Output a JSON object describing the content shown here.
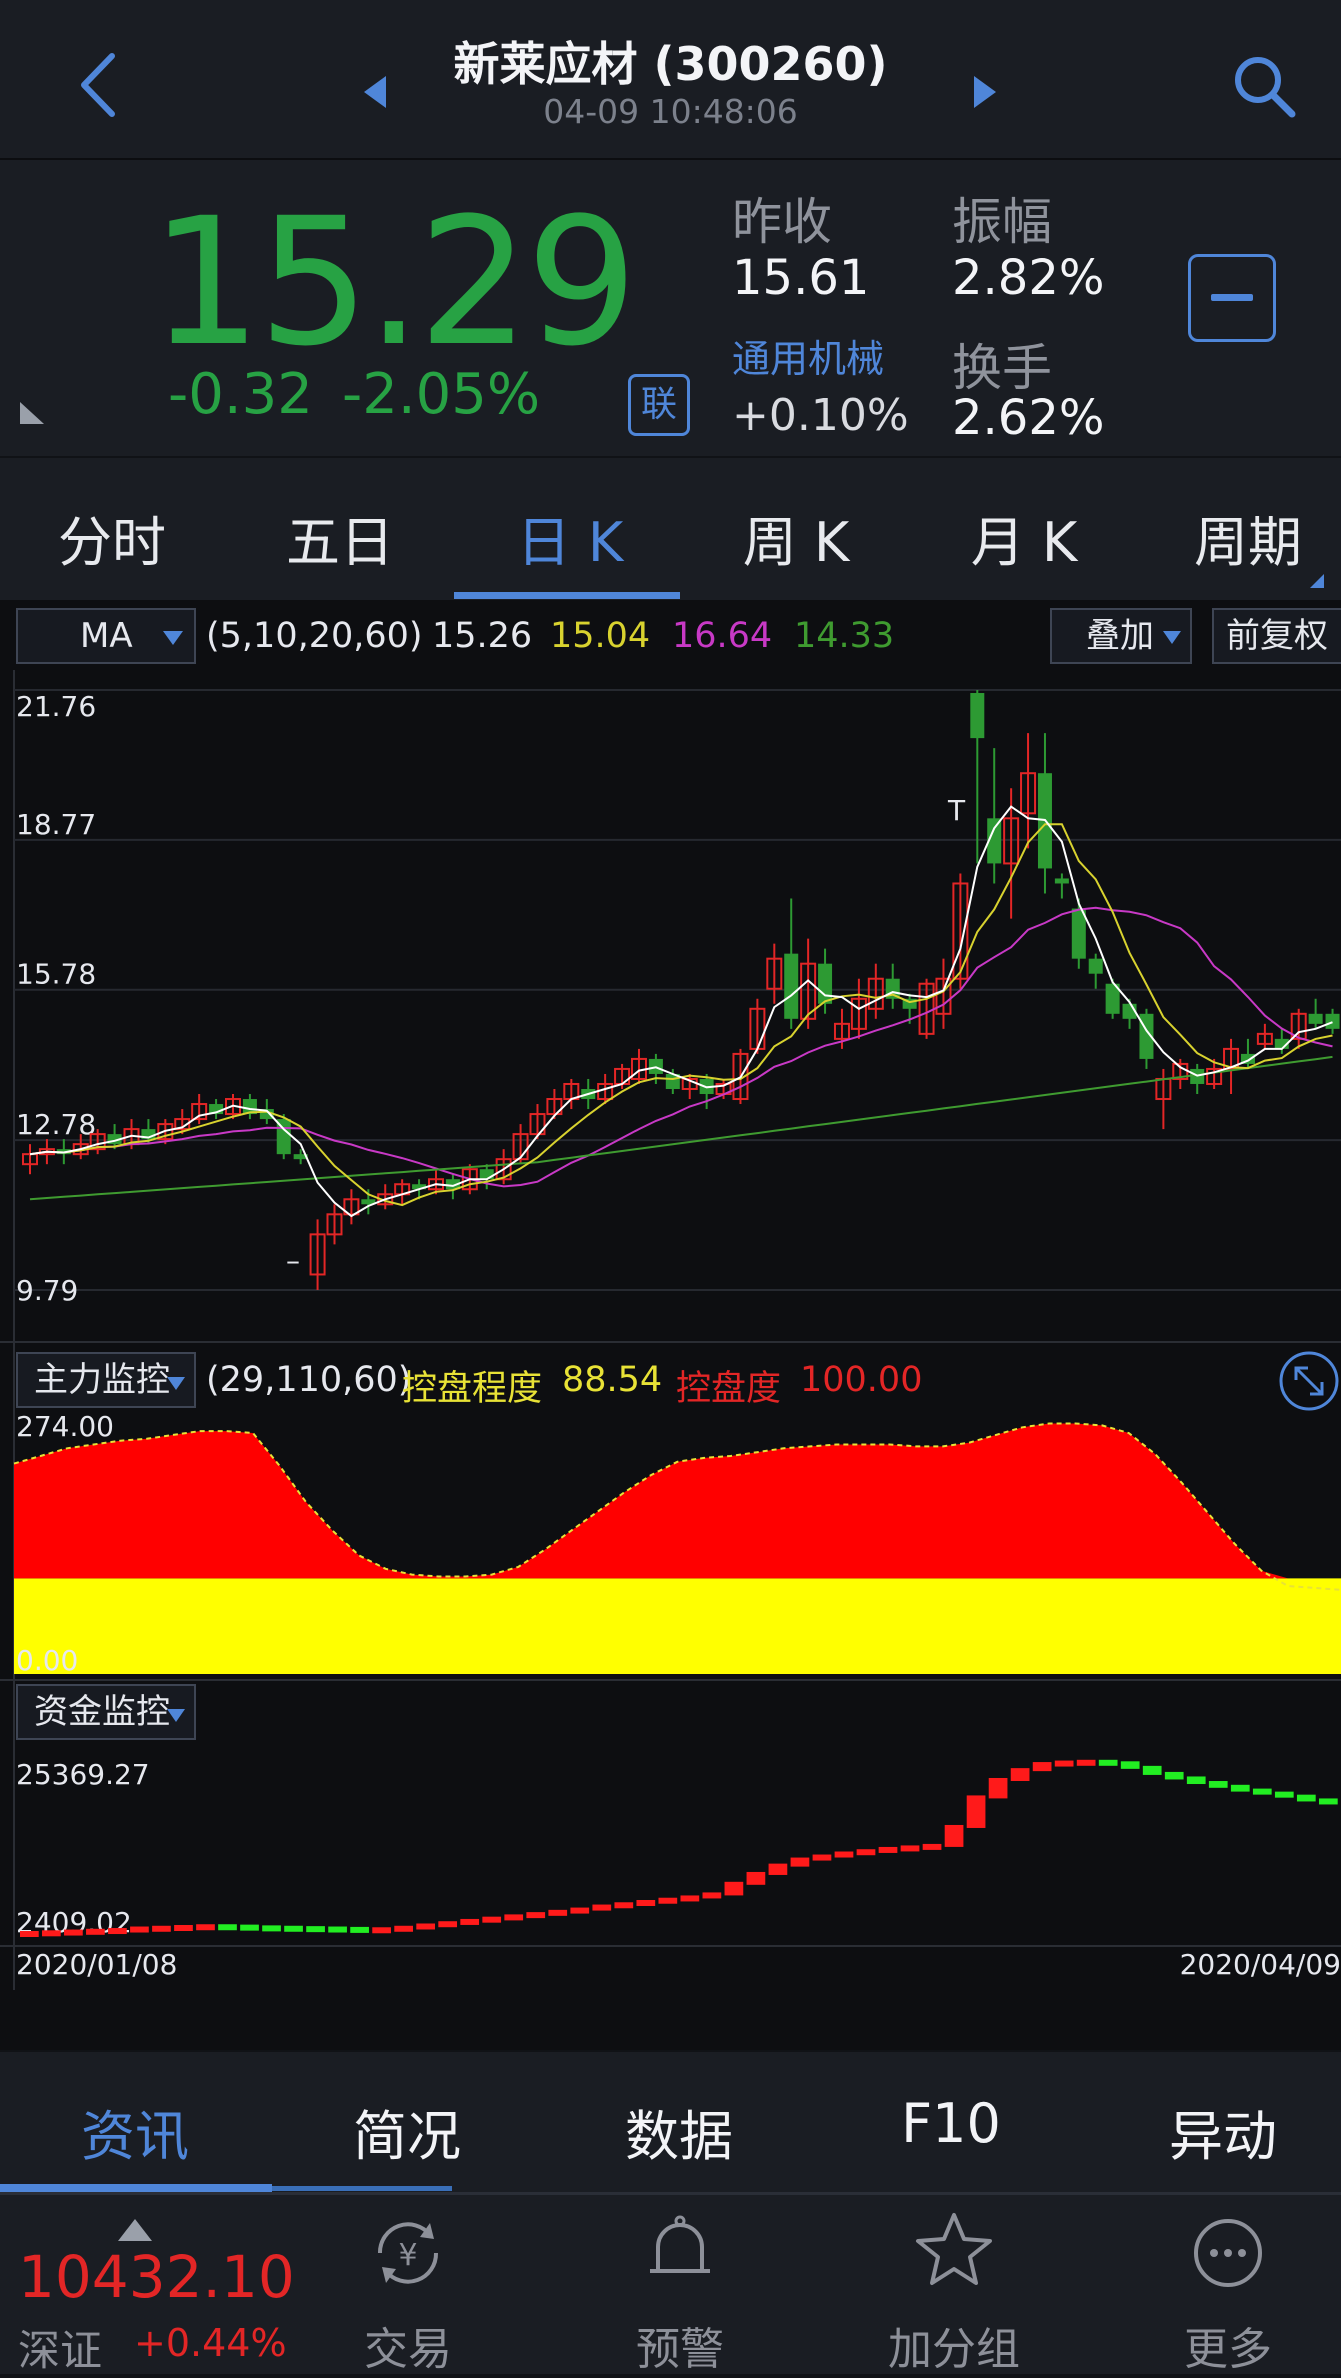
{
  "header": {
    "title": "新莱应材 (300260)",
    "datetime": "04-09 10:48:06"
  },
  "quote": {
    "price": "15.29",
    "change": "-0.32",
    "change_pct": "-2.05%",
    "prev_close_label": "昨收",
    "prev_close": "15.61",
    "amplitude_label": "振幅",
    "amplitude": "2.82%",
    "sector_label": "通用机械",
    "sector_change": "+0.10%",
    "turnover_label": "换手",
    "turnover": "2.62%",
    "link_badge": "联"
  },
  "tabs": [
    {
      "label": "分时"
    },
    {
      "label": "五日"
    },
    {
      "label": "日 K"
    },
    {
      "label": "周 K"
    },
    {
      "label": "月 K"
    },
    {
      "label": "周期"
    }
  ],
  "active_tab": "日 K",
  "ma_bar": {
    "select": "MA",
    "params": "(5,10,20,60)",
    "ma5": "15.26",
    "ma10": "15.04",
    "ma20": "16.64",
    "ma60": "14.33",
    "overlay": "叠加",
    "adjust": "前复权"
  },
  "colors": {
    "up": "#e32626",
    "down": "#2d9a33",
    "ma5": "#ffffff",
    "ma10": "#d8d22f",
    "ma20": "#c839c6",
    "ma60": "#3f9b30",
    "accent": "#4f86d9"
  },
  "chart_data": [
    {
      "type": "candlestick",
      "ylim": [
        9.79,
        21.76
      ],
      "y_ticks": [
        "21.76",
        "18.77",
        "15.78",
        "12.78",
        "9.79"
      ],
      "annotations": [
        "T",
        "–"
      ],
      "candles": [
        {
          "o": 12.3,
          "c": 12.5,
          "h": 12.7,
          "l": 12.1
        },
        {
          "o": 12.5,
          "c": 12.6,
          "h": 12.8,
          "l": 12.3
        },
        {
          "o": 12.6,
          "c": 12.5,
          "h": 12.8,
          "l": 12.3
        },
        {
          "o": 12.5,
          "c": 12.7,
          "h": 12.9,
          "l": 12.4
        },
        {
          "o": 12.6,
          "c": 12.9,
          "h": 13.0,
          "l": 12.5
        },
        {
          "o": 12.9,
          "c": 12.7,
          "h": 13.1,
          "l": 12.6
        },
        {
          "o": 12.7,
          "c": 13.0,
          "h": 13.2,
          "l": 12.6
        },
        {
          "o": 13.0,
          "c": 12.8,
          "h": 13.2,
          "l": 12.7
        },
        {
          "o": 12.8,
          "c": 13.1,
          "h": 13.2,
          "l": 12.7
        },
        {
          "o": 13.0,
          "c": 13.2,
          "h": 13.4,
          "l": 12.9
        },
        {
          "o": 13.2,
          "c": 13.5,
          "h": 13.7,
          "l": 13.1
        },
        {
          "o": 13.5,
          "c": 13.3,
          "h": 13.6,
          "l": 13.2
        },
        {
          "o": 13.3,
          "c": 13.6,
          "h": 13.7,
          "l": 13.2
        },
        {
          "o": 13.6,
          "c": 13.3,
          "h": 13.7,
          "l": 13.2
        },
        {
          "o": 13.4,
          "c": 13.2,
          "h": 13.6,
          "l": 13.1
        },
        {
          "o": 13.2,
          "c": 12.5,
          "h": 13.3,
          "l": 12.4
        },
        {
          "o": 12.5,
          "c": 12.4,
          "h": 12.6,
          "l": 12.3
        },
        {
          "o": 10.1,
          "c": 10.9,
          "h": 11.2,
          "l": 9.79
        },
        {
          "o": 10.9,
          "c": 11.3,
          "h": 11.5,
          "l": 10.7
        },
        {
          "o": 11.3,
          "c": 11.6,
          "h": 11.8,
          "l": 11.1
        },
        {
          "o": 11.6,
          "c": 11.5,
          "h": 11.8,
          "l": 11.3
        },
        {
          "o": 11.5,
          "c": 11.7,
          "h": 11.9,
          "l": 11.4
        },
        {
          "o": 11.7,
          "c": 11.9,
          "h": 12.0,
          "l": 11.5
        },
        {
          "o": 11.9,
          "c": 11.8,
          "h": 12.0,
          "l": 11.6
        },
        {
          "o": 11.8,
          "c": 12.0,
          "h": 12.2,
          "l": 11.7
        },
        {
          "o": 12.0,
          "c": 11.8,
          "h": 12.1,
          "l": 11.6
        },
        {
          "o": 11.8,
          "c": 12.2,
          "h": 12.3,
          "l": 11.7
        },
        {
          "o": 12.2,
          "c": 12.0,
          "h": 12.3,
          "l": 11.8
        },
        {
          "o": 12.0,
          "c": 12.4,
          "h": 12.6,
          "l": 11.9
        },
        {
          "o": 12.4,
          "c": 12.9,
          "h": 13.1,
          "l": 12.3
        },
        {
          "o": 12.9,
          "c": 13.3,
          "h": 13.5,
          "l": 12.8
        },
        {
          "o": 13.3,
          "c": 13.6,
          "h": 13.8,
          "l": 13.2
        },
        {
          "o": 13.6,
          "c": 13.9,
          "h": 14.0,
          "l": 13.4
        },
        {
          "o": 13.8,
          "c": 13.6,
          "h": 14.0,
          "l": 13.4
        },
        {
          "o": 13.6,
          "c": 13.9,
          "h": 14.1,
          "l": 13.5
        },
        {
          "o": 13.9,
          "c": 14.2,
          "h": 14.3,
          "l": 13.8
        },
        {
          "o": 14.0,
          "c": 14.4,
          "h": 14.6,
          "l": 13.9
        },
        {
          "o": 14.4,
          "c": 14.1,
          "h": 14.5,
          "l": 13.9
        },
        {
          "o": 14.1,
          "c": 13.8,
          "h": 14.2,
          "l": 13.7
        },
        {
          "o": 13.8,
          "c": 14.0,
          "h": 14.1,
          "l": 13.6
        },
        {
          "o": 14.0,
          "c": 13.7,
          "h": 14.1,
          "l": 13.4
        },
        {
          "o": 13.7,
          "c": 13.9,
          "h": 14.0,
          "l": 13.6
        },
        {
          "o": 13.6,
          "c": 14.5,
          "h": 14.6,
          "l": 13.5
        },
        {
          "o": 14.6,
          "c": 15.4,
          "h": 15.6,
          "l": 14.5
        },
        {
          "o": 15.8,
          "c": 16.4,
          "h": 16.7,
          "l": 15.5
        },
        {
          "o": 16.5,
          "c": 15.2,
          "h": 17.6,
          "l": 15.0
        },
        {
          "o": 15.2,
          "c": 16.3,
          "h": 16.8,
          "l": 15.0
        },
        {
          "o": 16.3,
          "c": 15.5,
          "h": 16.6,
          "l": 15.3
        },
        {
          "o": 14.8,
          "c": 15.1,
          "h": 15.4,
          "l": 14.6
        },
        {
          "o": 15.0,
          "c": 15.6,
          "h": 16.0,
          "l": 14.8
        },
        {
          "o": 15.4,
          "c": 16.0,
          "h": 16.3,
          "l": 15.2
        },
        {
          "o": 16.0,
          "c": 15.6,
          "h": 16.3,
          "l": 15.4
        },
        {
          "o": 15.6,
          "c": 15.4,
          "h": 15.7,
          "l": 15.1
        },
        {
          "o": 14.9,
          "c": 15.9,
          "h": 16.0,
          "l": 14.8
        },
        {
          "o": 15.3,
          "c": 16.0,
          "h": 16.4,
          "l": 15.0
        },
        {
          "o": 16.0,
          "c": 17.9,
          "h": 18.1,
          "l": 15.8
        },
        {
          "o": 21.7,
          "c": 20.8,
          "h": 21.76,
          "l": 18.3
        },
        {
          "o": 19.2,
          "c": 18.3,
          "h": 20.6,
          "l": 17.9
        },
        {
          "o": 18.3,
          "c": 19.2,
          "h": 19.8,
          "l": 17.2
        },
        {
          "o": 19.3,
          "c": 20.1,
          "h": 20.9,
          "l": 18.6
        },
        {
          "o": 20.1,
          "c": 18.2,
          "h": 20.9,
          "l": 17.7
        },
        {
          "o": 18.0,
          "c": 17.9,
          "h": 18.1,
          "l": 17.6
        },
        {
          "o": 17.4,
          "c": 16.4,
          "h": 17.6,
          "l": 16.2
        },
        {
          "o": 16.4,
          "c": 16.1,
          "h": 16.5,
          "l": 15.8
        },
        {
          "o": 15.9,
          "c": 15.3,
          "h": 16.0,
          "l": 15.2
        },
        {
          "o": 15.5,
          "c": 15.2,
          "h": 15.6,
          "l": 15.0
        },
        {
          "o": 15.3,
          "c": 14.4,
          "h": 15.4,
          "l": 14.2
        },
        {
          "o": 13.6,
          "c": 14.0,
          "h": 14.2,
          "l": 13.0
        },
        {
          "o": 14.0,
          "c": 14.3,
          "h": 14.4,
          "l": 13.8
        },
        {
          "o": 14.2,
          "c": 13.9,
          "h": 14.3,
          "l": 13.7
        },
        {
          "o": 13.9,
          "c": 14.2,
          "h": 14.4,
          "l": 13.8
        },
        {
          "o": 14.2,
          "c": 14.6,
          "h": 14.8,
          "l": 13.7
        },
        {
          "o": 14.5,
          "c": 14.3,
          "h": 14.8,
          "l": 14.2
        },
        {
          "o": 14.7,
          "c": 14.9,
          "h": 15.1,
          "l": 14.6
        },
        {
          "o": 14.8,
          "c": 14.6,
          "h": 15.0,
          "l": 14.5
        },
        {
          "o": 14.8,
          "c": 15.3,
          "h": 15.4,
          "l": 14.6
        },
        {
          "o": 15.3,
          "c": 15.1,
          "h": 15.6,
          "l": 15.0
        },
        {
          "o": 15.3,
          "c": 15.0,
          "h": 15.4,
          "l": 14.9
        }
      ]
    },
    {
      "type": "area",
      "title": "主力监控",
      "params": "(29,110,60)",
      "label1": "控盘程度",
      "value1": "88.54",
      "label2": "控盘度",
      "value2": "100.00",
      "y_ticks": [
        "274.00",
        "0.00"
      ],
      "ylim": [
        0,
        274
      ],
      "baseline": 100,
      "values": [
        220,
        228,
        236,
        240,
        244,
        246,
        250,
        254,
        254,
        252,
        218,
        180,
        150,
        124,
        110,
        104,
        102,
        102,
        104,
        112,
        130,
        150,
        170,
        190,
        208,
        222,
        226,
        228,
        232,
        236,
        238,
        240,
        240,
        240,
        238,
        238,
        242,
        250,
        258,
        262,
        262,
        260,
        252,
        230,
        200,
        168,
        136,
        108,
        92,
        90,
        88
      ]
    },
    {
      "type": "bar",
      "title": "资金监控",
      "y_ticks": [
        "25369.27",
        "2409.02"
      ],
      "ylim": [
        2409.02,
        25369.27
      ],
      "x_ticks": [
        "2020/01/08",
        "2020/04/09"
      ],
      "values": [
        2409,
        2500,
        2600,
        2700,
        2800,
        3000,
        3100,
        3200,
        3300,
        3250,
        3150,
        3100,
        3050,
        3000,
        2950,
        2900,
        2900,
        3100,
        3400,
        3700,
        4000,
        4300,
        4600,
        4900,
        5200,
        5500,
        5900,
        6200,
        6500,
        6800,
        7100,
        7500,
        8900,
        10200,
        11300,
        12100,
        12500,
        12900,
        13200,
        13500,
        13700,
        13900,
        16400,
        20300,
        22600,
        23900,
        24700,
        24900,
        25000,
        24800,
        24200,
        23400,
        22800,
        22200,
        21700,
        21200,
        20800,
        20400,
        19900,
        19600
      ]
    }
  ],
  "bottom_tabs": [
    {
      "label": "资讯"
    },
    {
      "label": "简况"
    },
    {
      "label": "数据"
    },
    {
      "label": "F10"
    },
    {
      "label": "异动"
    }
  ],
  "footer": {
    "index_value": "10432.10",
    "index_name": "深证",
    "index_change": "+0.44%",
    "items": [
      {
        "label": "交易"
      },
      {
        "label": "预警"
      },
      {
        "label": "加分组"
      },
      {
        "label": "更多"
      }
    ]
  }
}
